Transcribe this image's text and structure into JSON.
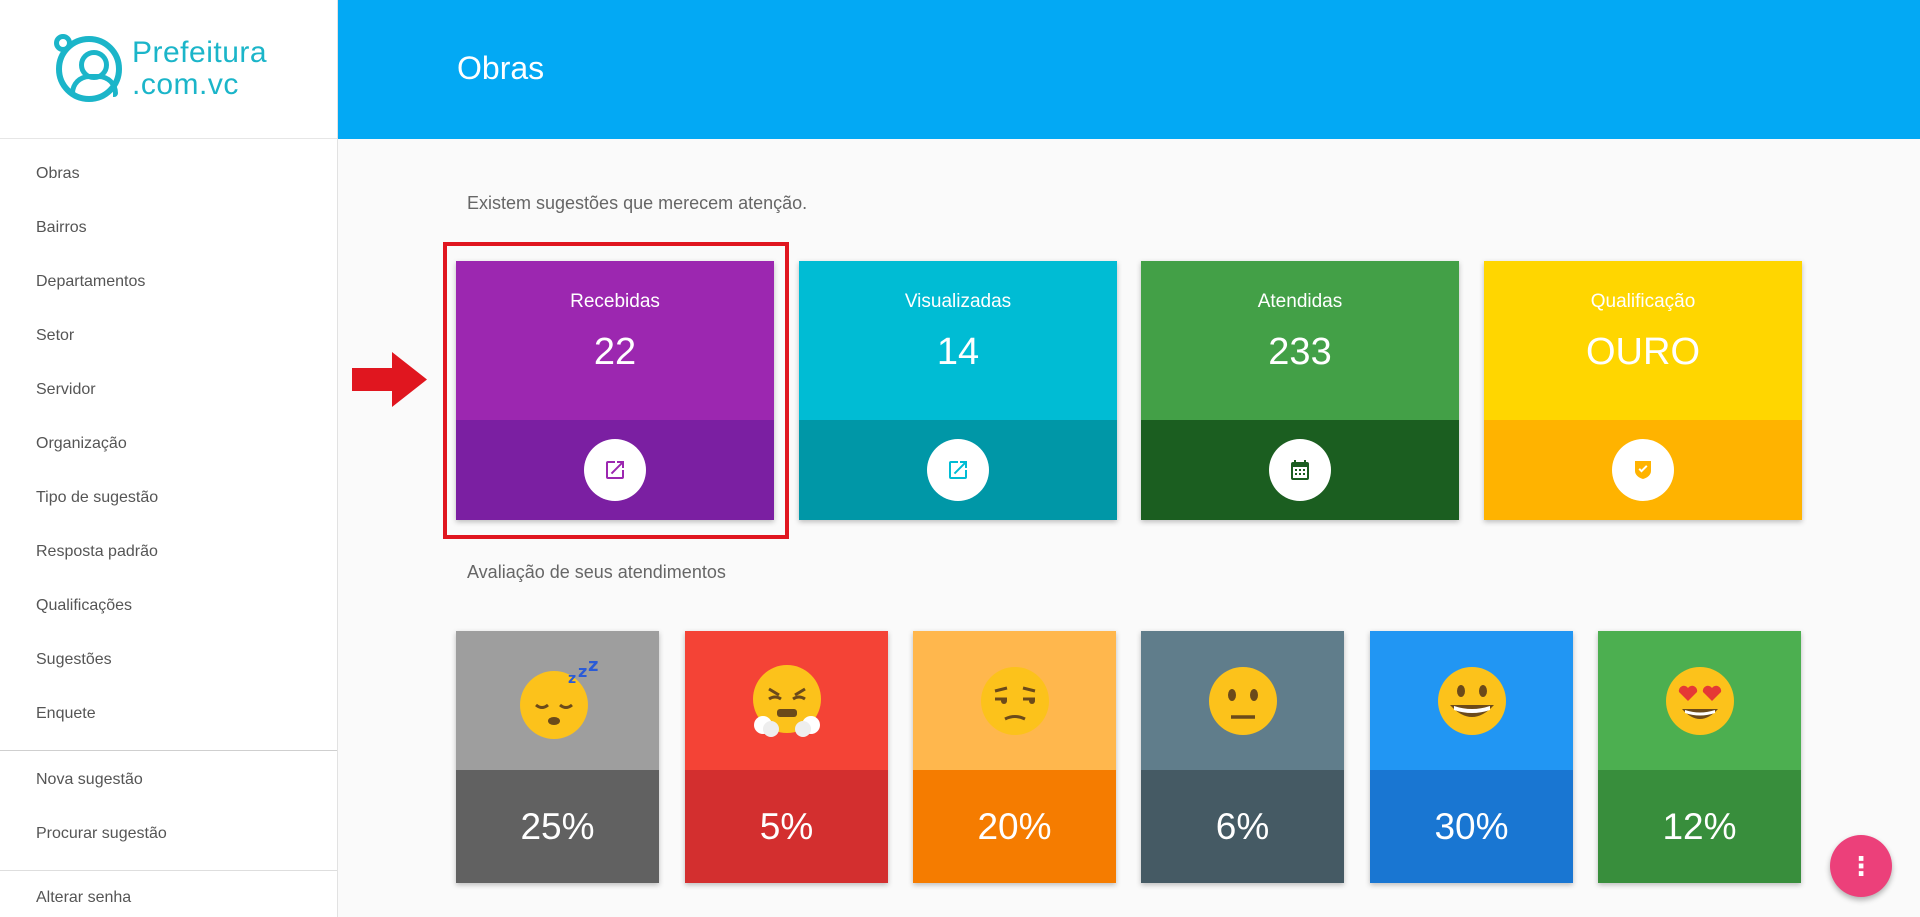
{
  "logo": {
    "line1": "Prefeitura",
    "line2": ".com.vc"
  },
  "sidebar": {
    "items": [
      {
        "label": "Obras"
      },
      {
        "label": "Bairros"
      },
      {
        "label": "Departamentos"
      },
      {
        "label": "Setor"
      },
      {
        "label": "Servidor"
      },
      {
        "label": "Organização"
      },
      {
        "label": "Tipo de sugestão"
      },
      {
        "label": "Resposta padrão"
      },
      {
        "label": "Qualificações"
      },
      {
        "label": "Sugestões"
      },
      {
        "label": "Enquete"
      }
    ],
    "group2": [
      {
        "label": "Nova sugestão"
      },
      {
        "label": "Procurar sugestão"
      }
    ],
    "group3": [
      {
        "label": "Alterar senha"
      }
    ]
  },
  "header": {
    "title": "Obras"
  },
  "main": {
    "attention_text": "Existem sugestões que merecem atenção.",
    "evaluation_text": "Avaliação de seus atendimentos",
    "stats": [
      {
        "label": "Recebidas",
        "value": "22",
        "icon": "open-in-new-icon",
        "color_top": "#9c27b0",
        "color_bottom": "#7b1fa2"
      },
      {
        "label": "Visualizadas",
        "value": "14",
        "icon": "open-in-new-icon",
        "color_top": "#00bcd4",
        "color_bottom": "#0097a7"
      },
      {
        "label": "Atendidas",
        "value": "233",
        "icon": "calendar-icon",
        "color_top": "#43a047",
        "color_bottom": "#1b5e20"
      },
      {
        "label": "Qualificação",
        "value": "OURO",
        "icon": "verified-shield-icon",
        "color_top": "#ffd600",
        "color_bottom": "#ffb300"
      }
    ],
    "evaluations": [
      {
        "emoji": "sleepy-face-icon",
        "percent": "25%",
        "color_top": "#9e9e9e",
        "color_bottom": "#616161"
      },
      {
        "emoji": "angry-steam-face-icon",
        "percent": "5%",
        "color_top": "#f44336",
        "color_bottom": "#d32f2f"
      },
      {
        "emoji": "unamused-face-icon",
        "percent": "20%",
        "color_top": "#ffb74d",
        "color_bottom": "#f57c00"
      },
      {
        "emoji": "neutral-face-icon",
        "percent": "6%",
        "color_top": "#607d8b",
        "color_bottom": "#455a64"
      },
      {
        "emoji": "grinning-face-icon",
        "percent": "30%",
        "color_top": "#2196f3",
        "color_bottom": "#1976d2"
      },
      {
        "emoji": "heart-eyes-face-icon",
        "percent": "12%",
        "color_top": "#4caf50",
        "color_bottom": "#388e3c"
      }
    ]
  },
  "fab": {
    "label": "⋮"
  }
}
